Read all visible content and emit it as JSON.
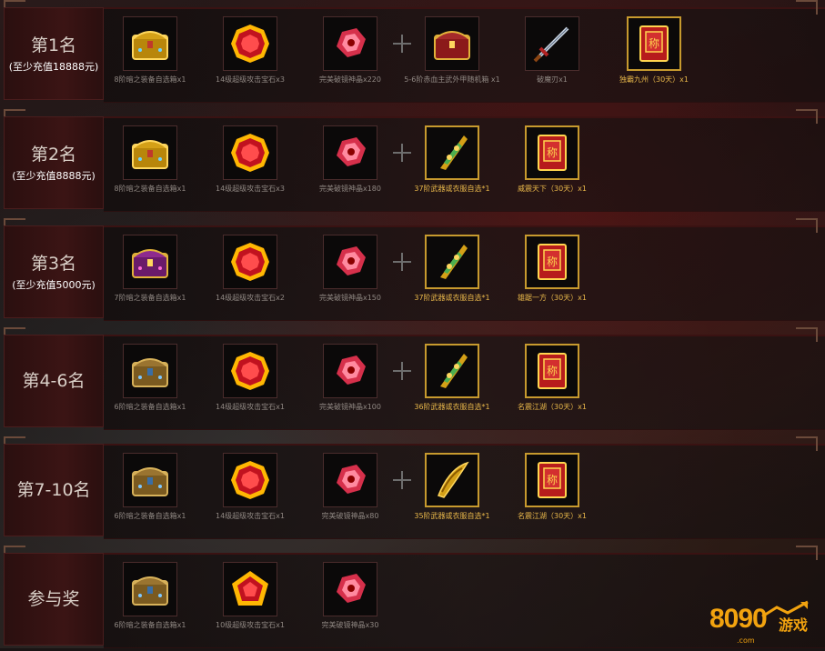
{
  "rows": [
    {
      "rank": "第1名",
      "note": "(至少充值18888元)",
      "items": [
        {
          "icon": "golden-chest-icon",
          "caption": "8阶暗之装备自选箱x1",
          "gold": false
        },
        {
          "icon": "red-gem-icon",
          "caption": "14级超级攻击宝石x3",
          "gold": false
        },
        {
          "icon": "crystal-icon",
          "caption": "完美破镜神晶x220",
          "gold": false
        },
        {
          "icon": "red-gold-chest-icon",
          "caption": "5-6阶赤血主武外甲随机箱 x1",
          "gold": false
        },
        {
          "icon": "sword-icon",
          "caption": "破魔刃x1",
          "gold": false
        },
        {
          "icon": "title-scroll-icon",
          "caption": "独霸九州（30天）x1",
          "gold": true
        }
      ]
    },
    {
      "rank": "第2名",
      "note": "(至少充值8888元)",
      "items": [
        {
          "icon": "golden-chest-icon",
          "caption": "8阶暗之装备自选箱x1",
          "gold": false
        },
        {
          "icon": "red-gem-icon",
          "caption": "14级超级攻击宝石x3",
          "gold": false
        },
        {
          "icon": "crystal-icon",
          "caption": "完美破镜神晶x180",
          "gold": false
        },
        {
          "icon": "golden-weapon-icon",
          "caption": "37阶武器或衣服自选*1",
          "gold": true
        },
        {
          "icon": "title-scroll-icon",
          "caption": "威震天下（30天）x1",
          "gold": true
        }
      ]
    },
    {
      "rank": "第3名",
      "note": "(至少充值5000元)",
      "items": [
        {
          "icon": "purple-chest-icon",
          "caption": "7阶暗之装备自选箱x1",
          "gold": false
        },
        {
          "icon": "red-gem-icon",
          "caption": "14级超级攻击宝石x2",
          "gold": false
        },
        {
          "icon": "crystal-icon",
          "caption": "完美破镜神晶x150",
          "gold": false
        },
        {
          "icon": "golden-weapon-icon",
          "caption": "37阶武器或衣服自选*1",
          "gold": true
        },
        {
          "icon": "title-scroll-icon",
          "caption": "雄踞一方（30天）x1",
          "gold": true
        }
      ]
    },
    {
      "rank": "第4-6名",
      "note": "",
      "items": [
        {
          "icon": "blue-chest-icon",
          "caption": "6阶暗之装备自选箱x1",
          "gold": false
        },
        {
          "icon": "red-gem-icon",
          "caption": "14级超级攻击宝石x1",
          "gold": false
        },
        {
          "icon": "crystal-icon",
          "caption": "完美破镜神晶x100",
          "gold": false
        },
        {
          "icon": "golden-weapon-icon",
          "caption": "36阶武器或衣服自选*1",
          "gold": true
        },
        {
          "icon": "title-scroll-icon",
          "caption": "名震江湖（30天）x1",
          "gold": true
        }
      ]
    },
    {
      "rank": "第7-10名",
      "note": "",
      "items": [
        {
          "icon": "blue-chest-icon",
          "caption": "6阶暗之装备自选箱x1",
          "gold": false
        },
        {
          "icon": "red-gem-icon",
          "caption": "14级超级攻击宝石x1",
          "gold": false
        },
        {
          "icon": "crystal-icon",
          "caption": "完美破镜神晶x80",
          "gold": false
        },
        {
          "icon": "golden-blade-icon",
          "caption": "35阶武器或衣服自选*1",
          "gold": true
        },
        {
          "icon": "title-scroll-icon",
          "caption": "名震江湖（30天）x1",
          "gold": true
        }
      ]
    },
    {
      "rank": "参与奖",
      "note": "",
      "items": [
        {
          "icon": "blue-chest-icon",
          "caption": "6阶暗之装备自选箱x1",
          "gold": false
        },
        {
          "icon": "red-gem-pentagon-icon",
          "caption": "10级超级攻击宝石x1",
          "gold": false
        },
        {
          "icon": "crystal-icon",
          "caption": "完美破镜神晶x30",
          "gold": false
        }
      ]
    }
  ],
  "logo": {
    "number": "8090",
    "domain": ".com",
    "name": "游戏"
  },
  "colors": {
    "gold_caption": "#e8b74a",
    "gold_border": "#c79a2e",
    "rank_bg": "#3b1414"
  }
}
